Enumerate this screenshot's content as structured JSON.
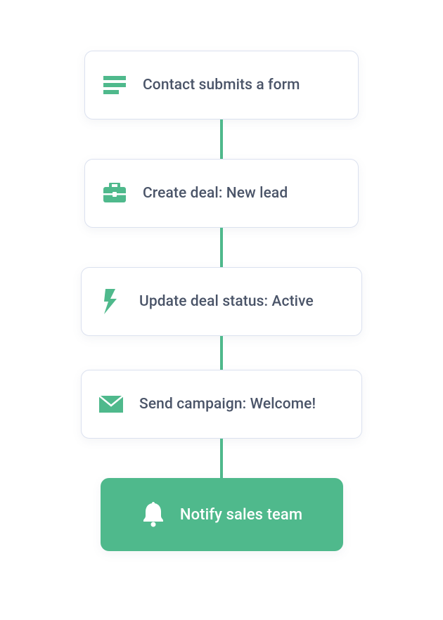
{
  "colors": {
    "accent": "#4fb98c",
    "text": "#4a5468",
    "border": "#dbe1ef"
  },
  "steps": [
    {
      "icon": "form-icon",
      "label": "Contact submits a form"
    },
    {
      "icon": "briefcase-icon",
      "label": "Create deal: New lead"
    },
    {
      "icon": "bolt-icon",
      "label": "Update deal status: Active"
    },
    {
      "icon": "envelope-icon",
      "label": "Send campaign: Welcome!"
    },
    {
      "icon": "bell-icon",
      "label": "Notify sales team"
    }
  ]
}
